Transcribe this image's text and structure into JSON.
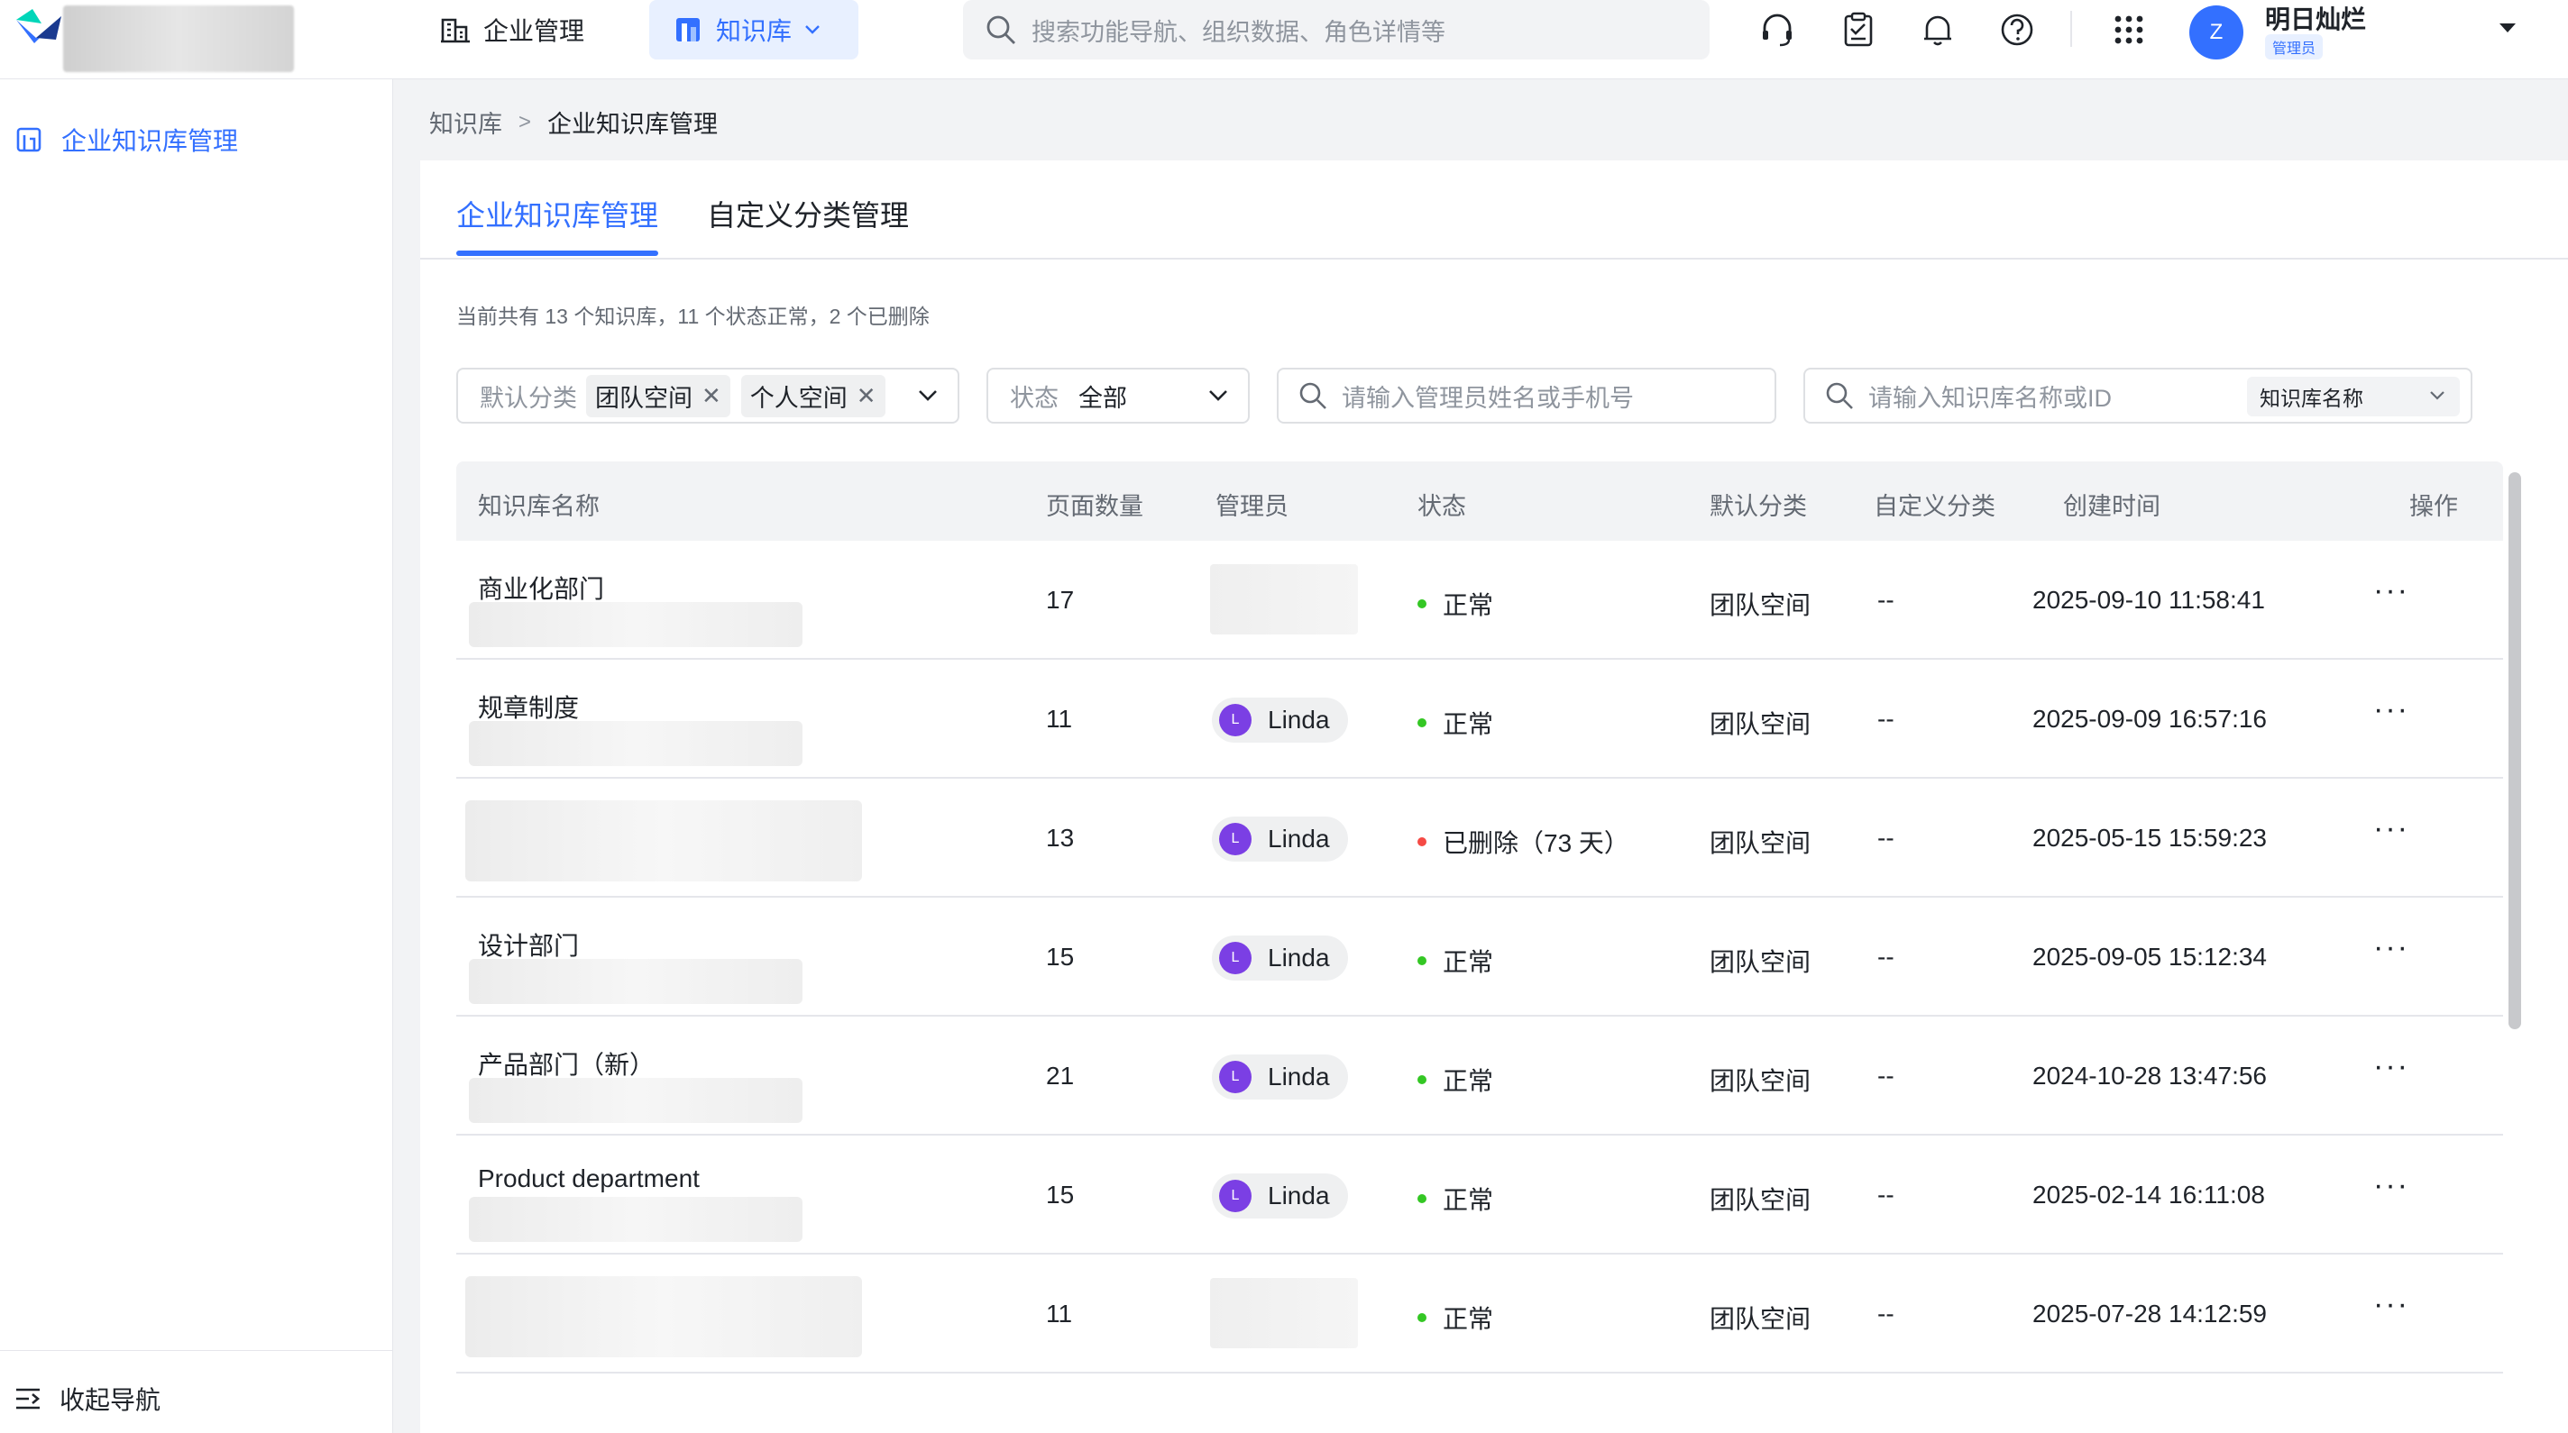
{
  "header": {
    "nav_enterprise": "企业管理",
    "nav_knowledge": "知识库",
    "search_placeholder": "搜索功能导航、组织数据、角色详情等",
    "user": {
      "avatar_letter": "Z",
      "name": "明日灿烂",
      "role": "管理员"
    }
  },
  "sidebar": {
    "item_label": "企业知识库管理",
    "collapse_label": "收起导航"
  },
  "breadcrumb": {
    "root": "知识库",
    "sep": ">",
    "current": "企业知识库管理"
  },
  "tabs": [
    {
      "label": "企业知识库管理",
      "active": true
    },
    {
      "label": "自定义分类管理",
      "active": false
    }
  ],
  "summary": "当前共有 13 个知识库，11 个状态正常，2 个已删除",
  "filters": {
    "category_label": "默认分类",
    "category_tags": [
      "团队空间",
      "个人空间"
    ],
    "tag_close": "✕",
    "status_label": "状态",
    "status_value": "全部",
    "admin_placeholder": "请输入管理员姓名或手机号",
    "name_placeholder": "请输入知识库名称或ID",
    "name_type": "知识库名称"
  },
  "table": {
    "headers": {
      "name": "知识库名称",
      "pages": "页面数量",
      "admin": "管理员",
      "status": "状态",
      "default_cat": "默认分类",
      "custom_cat": "自定义分类",
      "created": "创建时间",
      "ops": "操作"
    },
    "rows": [
      {
        "name": "商业化部门",
        "pages": "17",
        "admin": "",
        "status": "正常",
        "status_color": "#34c724",
        "default_cat": "团队空间",
        "custom_cat": "--",
        "created": "2025-09-10 11:58:41",
        "ops": "···"
      },
      {
        "name": "规章制度",
        "pages": "11",
        "admin": "Linda",
        "status": "正常",
        "status_color": "#34c724",
        "default_cat": "团队空间",
        "custom_cat": "--",
        "created": "2025-09-09 16:57:16",
        "ops": "···"
      },
      {
        "name": "",
        "pages": "13",
        "admin": "Linda",
        "status": "已删除（73 天）",
        "status_color": "#f54a45",
        "default_cat": "团队空间",
        "custom_cat": "--",
        "created": "2025-05-15 15:59:23",
        "ops": "···"
      },
      {
        "name": "设计部门",
        "pages": "15",
        "admin": "Linda",
        "status": "正常",
        "status_color": "#34c724",
        "default_cat": "团队空间",
        "custom_cat": "--",
        "created": "2025-09-05 15:12:34",
        "ops": "···"
      },
      {
        "name": "产品部门（新）",
        "pages": "21",
        "admin": "Linda",
        "status": "正常",
        "status_color": "#34c724",
        "default_cat": "团队空间",
        "custom_cat": "--",
        "created": "2024-10-28 13:47:56",
        "ops": "···"
      },
      {
        "name": "Product department",
        "pages": "15",
        "admin": "Linda",
        "status": "正常",
        "status_color": "#34c724",
        "default_cat": "团队空间",
        "custom_cat": "--",
        "created": "2025-02-14 16:11:08",
        "ops": "···"
      },
      {
        "name": "",
        "pages": "11",
        "admin": "",
        "status": "正常",
        "status_color": "#34c724",
        "default_cat": "团队空间",
        "custom_cat": "--",
        "created": "2025-07-28 14:12:59",
        "ops": "···"
      }
    ],
    "avatar_letter": "L"
  },
  "colors": {
    "accent": "#3370ff",
    "avatar": "#7b3fe4",
    "ok": "#34c724",
    "deleted": "#f54a45"
  }
}
